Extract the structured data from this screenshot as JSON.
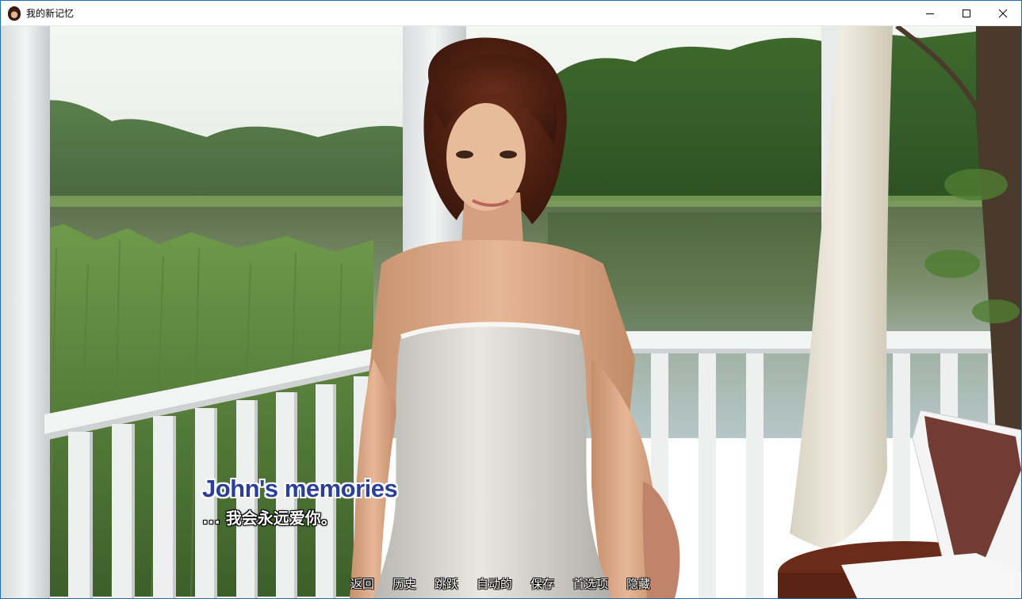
{
  "window": {
    "title": "我的新记忆",
    "app_icon": "character-portrait-icon",
    "controls": [
      "minimize-icon",
      "maximize-icon",
      "close-icon"
    ]
  },
  "dialogue": {
    "speaker": "John's memories",
    "text": "... 我会永远爱你。",
    "speaker_color": "#2a3f9a"
  },
  "quick_menu": [
    {
      "label": "返回"
    },
    {
      "label": "历史"
    },
    {
      "label": "跳跃"
    },
    {
      "label": "自动的"
    },
    {
      "label": "保存"
    },
    {
      "label": "首选项"
    },
    {
      "label": "隐藏"
    }
  ]
}
